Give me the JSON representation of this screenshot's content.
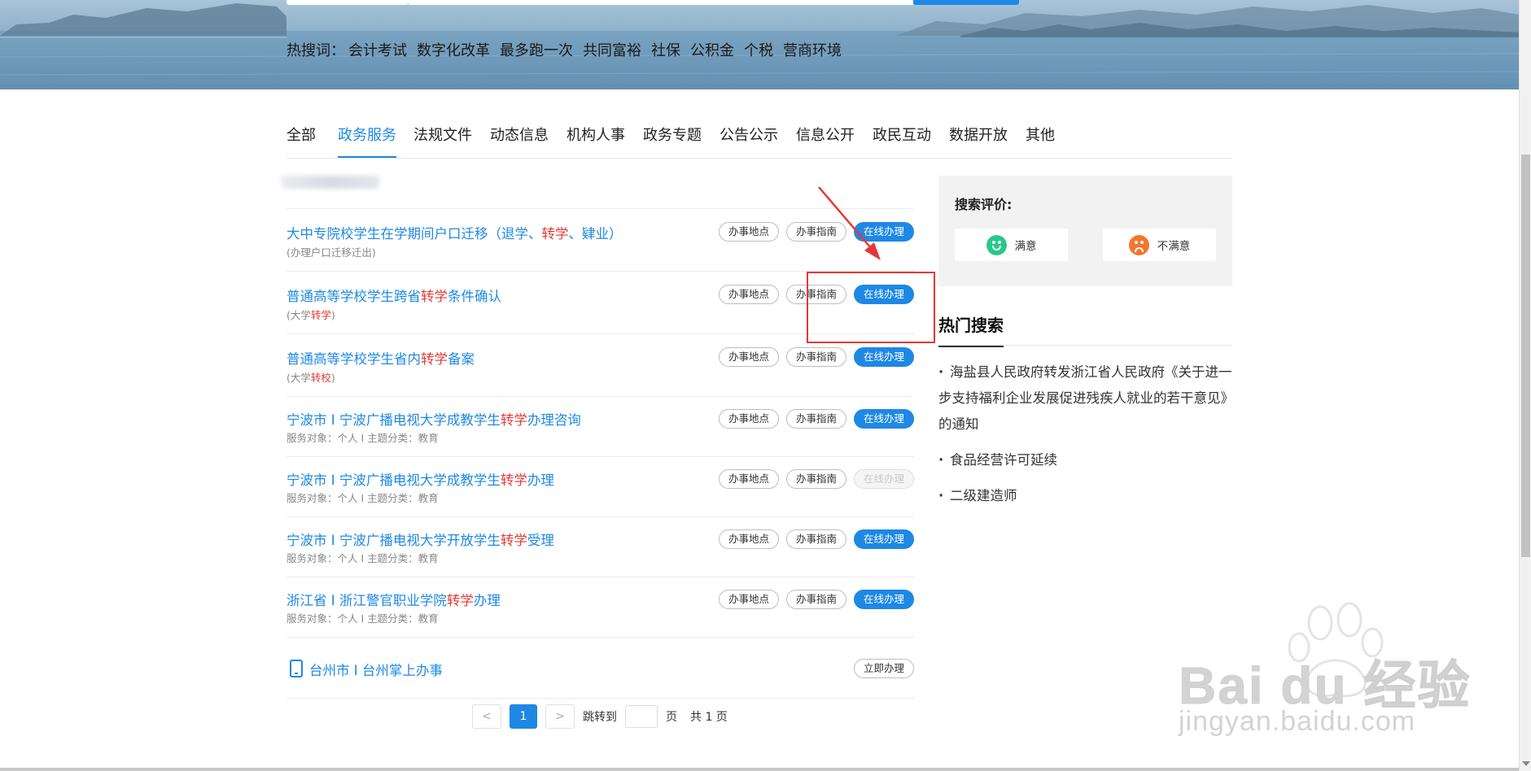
{
  "banner": {
    "hot_label": "热搜词：",
    "hot_words": [
      "会计考试",
      "数字化改革",
      "最多跑一次",
      "共同富裕",
      "社保",
      "公积金",
      "个税",
      "营商环境"
    ]
  },
  "tabs": [
    "全部",
    "政务服务",
    "法规文件",
    "动态信息",
    "机构人事",
    "政务专题",
    "公告公示",
    "信息公开",
    "政民互动",
    "数据开放",
    "其他"
  ],
  "active_tab": "政务服务",
  "results": [
    {
      "title_pre": "大中专院校学生在学期间户口迁移（退学、",
      "title_hl": "转学",
      "title_post": "、肄业）",
      "sub_pre": "(办理户口迁移迁出)",
      "sub_hl": "",
      "sub_post": "",
      "btn_place": "办事地点",
      "btn_guide": "办事指南",
      "btn_online": "在线办理",
      "online_enabled": true
    },
    {
      "title_pre": "普通高等学校学生跨省",
      "title_hl": "转学",
      "title_post": "条件确认",
      "sub_pre": "(大学",
      "sub_hl": "转学",
      "sub_post": ")",
      "btn_place": "办事地点",
      "btn_guide": "办事指南",
      "btn_online": "在线办理",
      "online_enabled": true
    },
    {
      "title_pre": "普通高等学校学生省内",
      "title_hl": "转学",
      "title_post": "备案",
      "sub_pre": "(大学",
      "sub_hl": "转校",
      "sub_post": ")",
      "btn_place": "办事地点",
      "btn_guide": "办事指南",
      "btn_online": "在线办理",
      "online_enabled": true
    },
    {
      "title_pre": "宁波市 I 宁波广播电视大学成教学生",
      "title_hl": "转学",
      "title_post": "办理咨询",
      "sub_pre": "服务对象：个人  I  主题分类：教育",
      "sub_hl": "",
      "sub_post": "",
      "btn_place": "办事地点",
      "btn_guide": "办事指南",
      "btn_online": "在线办理",
      "online_enabled": true
    },
    {
      "title_pre": "宁波市 I 宁波广播电视大学成教学生",
      "title_hl": "转学",
      "title_post": "办理",
      "sub_pre": "服务对象：个人  I  主题分类：教育",
      "sub_hl": "",
      "sub_post": "",
      "btn_place": "办事地点",
      "btn_guide": "办事指南",
      "btn_online": "在线办理",
      "online_enabled": false
    },
    {
      "title_pre": "宁波市 I 宁波广播电视大学开放学生",
      "title_hl": "转学",
      "title_post": "受理",
      "sub_pre": "服务对象：个人  I  主题分类：教育",
      "sub_hl": "",
      "sub_post": "",
      "btn_place": "办事地点",
      "btn_guide": "办事指南",
      "btn_online": "在线办理",
      "online_enabled": true
    },
    {
      "title_pre": "浙江省 I 浙江警官职业学院",
      "title_hl": "转学",
      "title_post": "办理",
      "sub_pre": "服务对象：个人  I  主题分类：教育",
      "sub_hl": "",
      "sub_post": "",
      "btn_place": "办事地点",
      "btn_guide": "办事指南",
      "btn_online": "在线办理",
      "online_enabled": true
    }
  ],
  "app_result": {
    "title": "台州市 I 台州掌上办事",
    "button": "立即办理",
    "icon": "mobile-phone-icon"
  },
  "pager": {
    "prev": "<",
    "current": "1",
    "next": ">",
    "jump_label": "跳转到",
    "page_unit": "页",
    "total": "共 1 页"
  },
  "evaluation": {
    "title": "搜索评价:",
    "good": "满意",
    "bad": "不满意",
    "good_icon": "smile-face-icon",
    "bad_icon": "sad-face-icon"
  },
  "hot_search": {
    "title": "热门搜索",
    "items": [
      "海盐县人民政府转发浙江省人民政府《关于进一步支持福利企业发展促进残疾人就业的若干意见》的通知",
      "食品经营许可延续",
      "二级建造师"
    ]
  },
  "watermark": {
    "text": "Bai du 经验",
    "sub": "jingyan.baidu.com"
  },
  "colors": {
    "accent": "#1e88e5",
    "highlight": "#e53935",
    "annotation": "#e53935"
  }
}
